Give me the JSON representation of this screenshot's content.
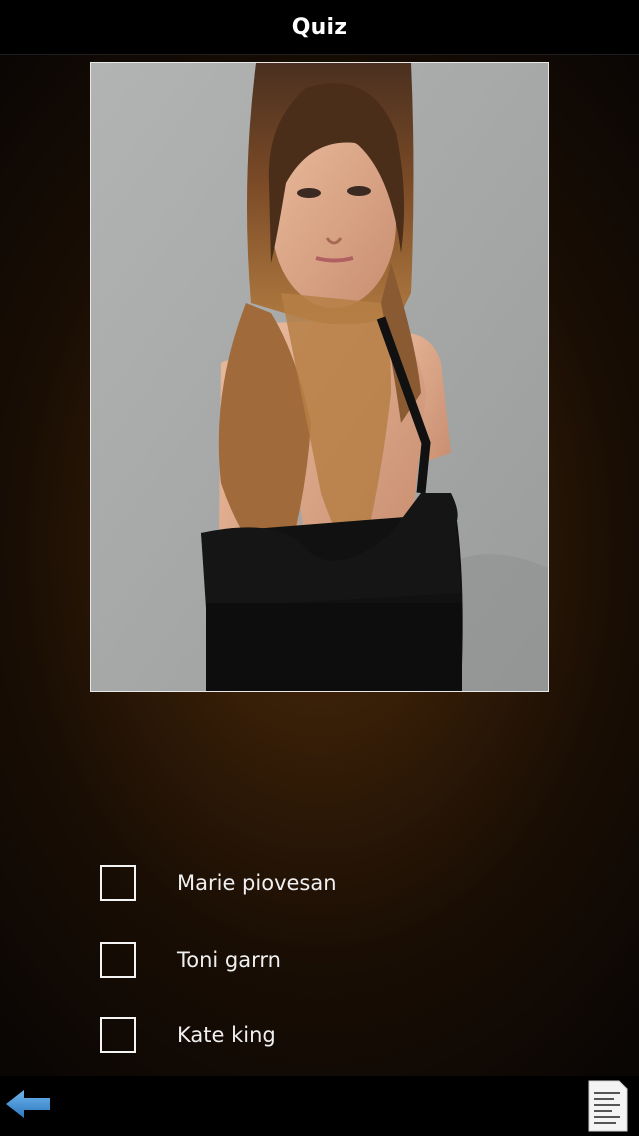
{
  "header": {
    "title": "Quiz"
  },
  "options": [
    {
      "label": "Marie piovesan",
      "checked": false
    },
    {
      "label": "Toni garrn",
      "checked": false
    },
    {
      "label": "Kate king",
      "checked": false
    }
  ],
  "footer": {
    "back_icon": "back-arrow-icon",
    "menu_icon": "document-list-icon"
  },
  "colors": {
    "background_center": "#4a2a0a",
    "background_edge": "#0a0604",
    "bars": "#000000",
    "accent_blue": "#3f8fd2",
    "text": "#f0f0f0"
  }
}
